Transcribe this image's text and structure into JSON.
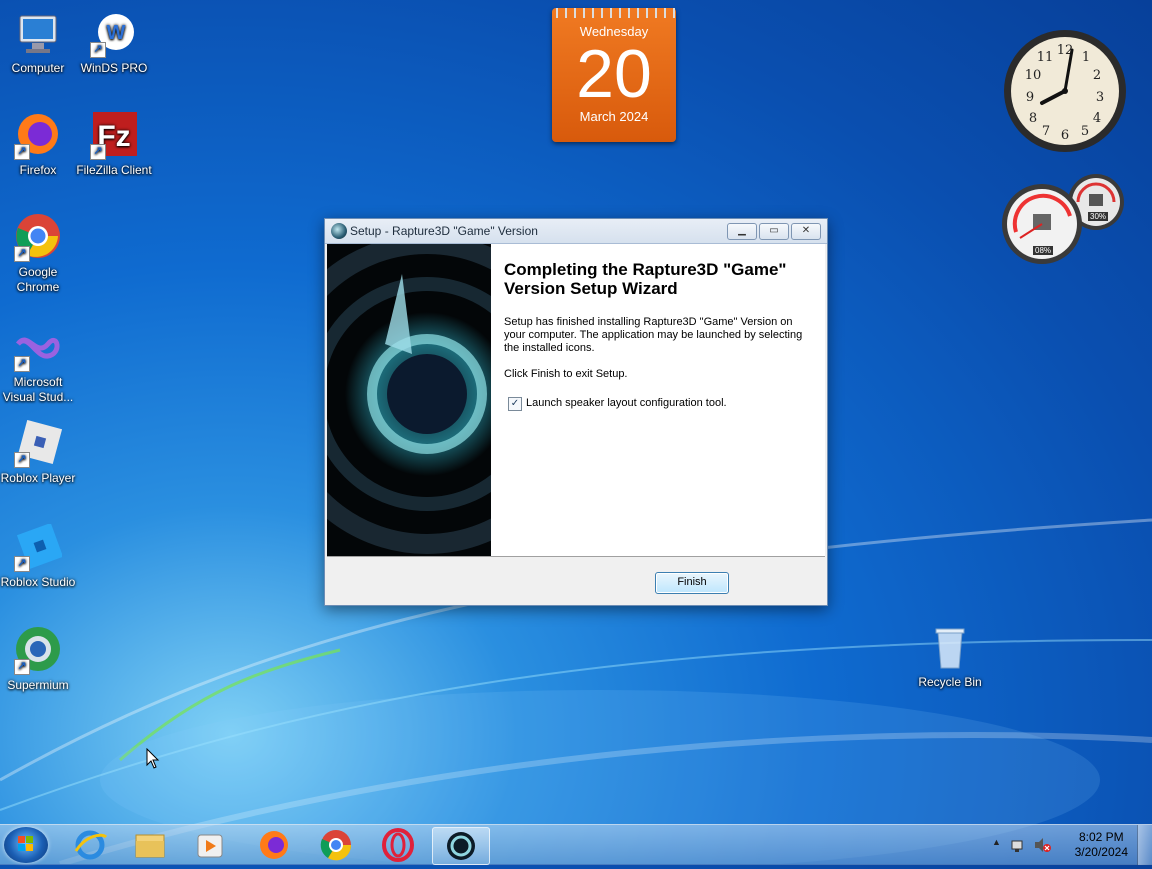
{
  "desktop": {
    "icons_left": [
      {
        "label": "Computer",
        "icon": "computer-icon"
      },
      {
        "label": "WinDS PRO",
        "icon": "winds-pro-icon"
      },
      {
        "label": "Firefox",
        "icon": "firefox-icon"
      },
      {
        "label": "FileZilla Client",
        "icon": "filezilla-icon"
      },
      {
        "label": "Google Chrome",
        "icon": "chrome-icon"
      },
      {
        "label": "Microsoft Visual Stud...",
        "icon": "visual-studio-icon"
      },
      {
        "label": "Roblox Player",
        "icon": "roblox-player-icon"
      },
      {
        "label": "Roblox Studio",
        "icon": "roblox-studio-icon"
      },
      {
        "label": "Supermium",
        "icon": "supermium-icon"
      }
    ],
    "recycle_bin": {
      "label": "Recycle Bin",
      "icon": "recycle-bin-icon"
    }
  },
  "calendar_gadget": {
    "weekday": "Wednesday",
    "day": "20",
    "month_year": "March 2024"
  },
  "gauges_gadget": {
    "cpu": "08%",
    "memory": "30%"
  },
  "dialog": {
    "title": "Setup - Rapture3D \"Game\" Version",
    "heading": "Completing the Rapture3D \"Game\" Version Setup Wizard",
    "body1": "Setup has finished installing Rapture3D \"Game\" Version on your computer. The application may be launched by selecting the installed icons.",
    "body2": "Click Finish to exit Setup.",
    "checkbox_label": "Launch speaker layout configuration tool.",
    "checkbox_checked": true,
    "finish_label": "Finish"
  },
  "taskbar": {
    "items": [
      "internet-explorer-icon",
      "file-explorer-icon",
      "media-player-icon",
      "firefox-icon",
      "chrome-icon",
      "opera-icon",
      "rapture3d-setup-icon"
    ],
    "time": "8:02 PM",
    "date": "3/20/2024"
  },
  "colors": {
    "accent": "#0f6bd0",
    "calendar": "#e86a18",
    "finish_border": "#3c7fb1"
  }
}
